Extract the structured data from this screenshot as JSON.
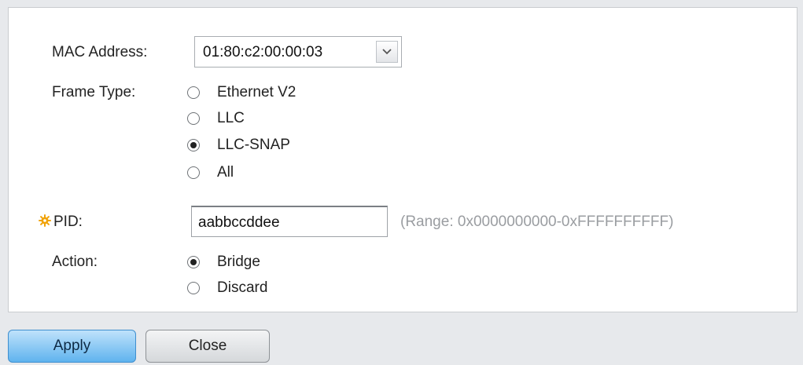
{
  "form": {
    "mac_label": "MAC Address:",
    "mac_value": "01:80:c2:00:00:03",
    "frame_type_label": "Frame Type:",
    "frame_types": [
      {
        "label": "Ethernet V2",
        "selected": false
      },
      {
        "label": "LLC",
        "selected": false
      },
      {
        "label": "LLC-SNAP",
        "selected": true
      },
      {
        "label": "All",
        "selected": false
      }
    ],
    "pid_label": "PID:",
    "pid_value": "aabbccddee",
    "pid_hint": "(Range: 0x0000000000-0xFFFFFFFFFF)",
    "action_label": "Action:",
    "actions": [
      {
        "label": "Bridge",
        "selected": true
      },
      {
        "label": "Discard",
        "selected": false
      }
    ]
  },
  "buttons": {
    "apply_label": "Apply",
    "close_label": "Close"
  },
  "icons": {
    "required": "required-gear-icon",
    "dropdown": "chevron-down-icon"
  },
  "colors": {
    "required_icon": "#f0a30a",
    "apply_button": "#5fb3ee",
    "hint_text": "#9a9da1"
  }
}
